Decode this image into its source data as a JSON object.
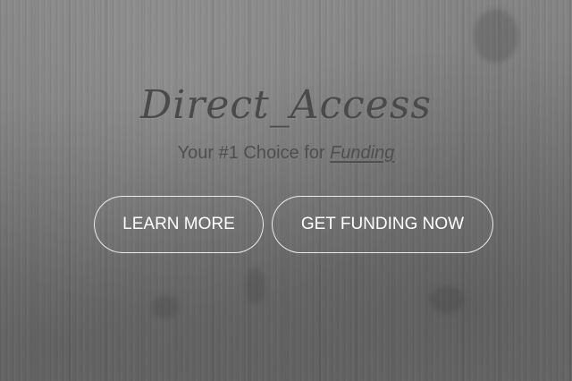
{
  "hero": {
    "brand_title": "Direct_Access",
    "tagline_prefix": "Your #1 Choice for ",
    "tagline_emphasis": "Funding"
  },
  "buttons": {
    "learn_more": "LEARN MORE",
    "get_funding": "GET FUNDING NOW"
  },
  "colors": {
    "background": "#7d7d7d",
    "title": "#4a4a4a",
    "tagline": "#4f4f4f",
    "button_text": "#ffffff",
    "button_border": "#ffffff"
  }
}
